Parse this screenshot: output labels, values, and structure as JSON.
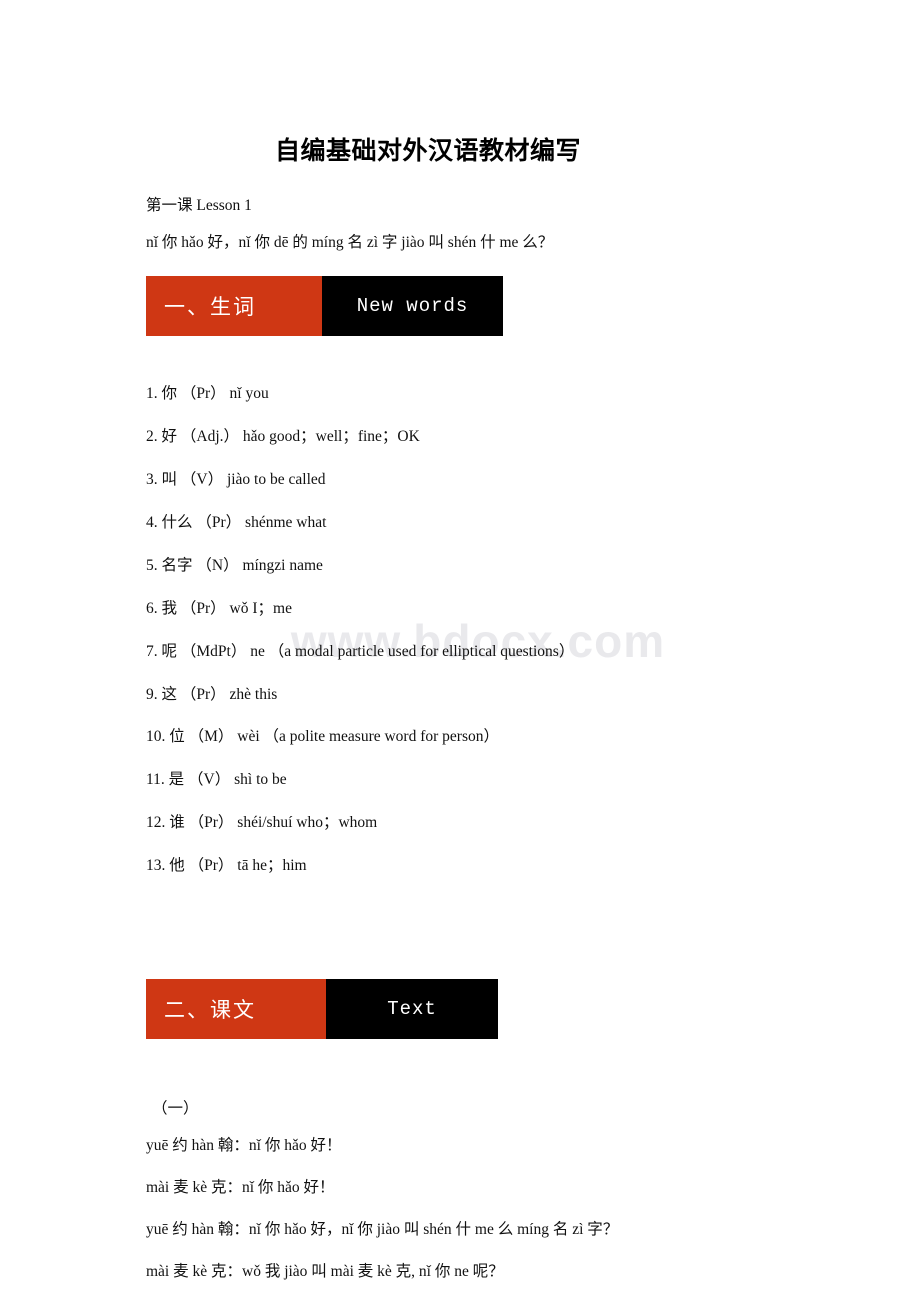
{
  "document": {
    "title": "自编基础对外汉语教材编写",
    "lesson_heading": "第一课 Lesson 1",
    "intro_line": "nǐ 你 hǎo 好，nǐ 你 dē 的 míng 名 zì 字 jiào 叫 shén 什 me 么？",
    "watermark": "www.bdocx.com"
  },
  "sections": {
    "new_words": {
      "banner_cn": "一、生词",
      "banner_en": "New words",
      "items": [
        "1. 你 （Pr） nǐ you",
        "2. 好 （Adj.） hǎo good；well；fine；OK",
        "3. 叫 （V） jiào to be called",
        "4. 什么 （Pr） shénme what",
        "5. 名字 （N） míngzi name",
        "6. 我 （Pr） wǒ I；me",
        "7. 呢 （MdPt） ne （a modal particle used for elliptical questions）",
        "9. 这 （Pr） zhè this",
        "10. 位 （M） wèi （a polite measure word for person）",
        "11. 是 （V） shì to be",
        "12. 谁 （Pr） shéi/shuí who；whom",
        "13. 他 （Pr） tā he；him"
      ]
    },
    "text": {
      "banner_cn": "二、课文",
      "banner_en": "Text",
      "subsection_label": "（一）",
      "dialogue": [
        "yuē 约 hàn 翰：nǐ 你 hǎo 好！",
        "mài 麦 kè 克：nǐ 你 hǎo 好！",
        "yuē 约 hàn 翰：nǐ 你 hǎo 好，nǐ 你 jiào 叫 shén 什 me 么 míng 名 zì 字？",
        "mài 麦 kè 克：wǒ 我 jiào 叫 mài 麦 kè 克, nǐ 你 ne 呢？"
      ]
    }
  },
  "colors": {
    "banner_orange": "#cf3714",
    "banner_black": "#000000",
    "watermark_gray": "#e9e9ec"
  }
}
